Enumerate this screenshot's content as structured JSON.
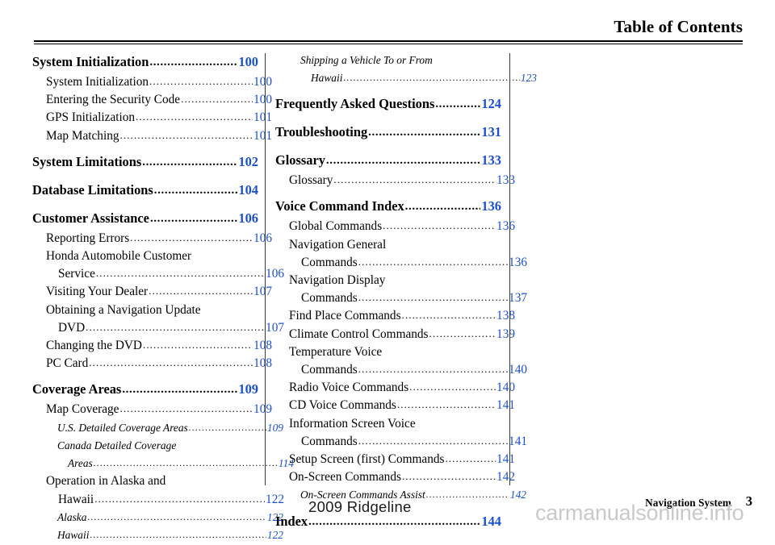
{
  "header": {
    "title": "Table of Contents"
  },
  "footer": {
    "model": "2009  Ridgeline",
    "section": "Navigation System",
    "page_number": "3",
    "watermark": "carmanualsonline.info"
  },
  "colors": {
    "page_number_blue": "#1a4fd0",
    "text_black": "#000000",
    "watermark_gray": "#c9c9c9",
    "divider_gray": "#3a3a3a"
  },
  "leader": "..................................................................................",
  "toc": {
    "left_column": [
      {
        "level": 1,
        "label": "System Initialization",
        "page": "100"
      },
      {
        "level": 2,
        "label": "System Initialization",
        "page": "100"
      },
      {
        "level": 2,
        "label": "Entering the Security Code",
        "page": "100"
      },
      {
        "level": 2,
        "label": "GPS Initialization",
        "page": "101"
      },
      {
        "level": 2,
        "label": "Map Matching",
        "page": "101"
      },
      {
        "level": 1,
        "label": "System Limitations",
        "page": "102"
      },
      {
        "level": 1,
        "label": "Database Limitations",
        "page": "104"
      },
      {
        "level": 1,
        "label": "Customer Assistance",
        "page": "106"
      },
      {
        "level": 2,
        "label": "Reporting Errors",
        "page": "106"
      },
      {
        "level": 2,
        "label": "Honda Automobile Customer",
        "page": "",
        "textonly": true
      },
      {
        "level": 2,
        "label": "Service",
        "page": "106",
        "cont": true
      },
      {
        "level": 2,
        "label": "Visiting Your Dealer",
        "page": "107"
      },
      {
        "level": 2,
        "label": "Obtaining a Navigation Update",
        "page": "",
        "textonly": true
      },
      {
        "level": 2,
        "label": "DVD",
        "page": "107",
        "cont": true
      },
      {
        "level": 2,
        "label": "Changing the DVD",
        "page": "108"
      },
      {
        "level": 2,
        "label": "PC Card",
        "page": "108"
      },
      {
        "level": 1,
        "label": "Coverage Areas",
        "page": "109"
      },
      {
        "level": 2,
        "label": "Map Coverage",
        "page": "109"
      },
      {
        "level": 3,
        "label": "U.S. Detailed Coverage Areas",
        "page": "109"
      },
      {
        "level": 3,
        "label": "Canada Detailed Coverage",
        "page": "",
        "textonly": true
      },
      {
        "level": 3,
        "label": "Areas",
        "page": "114",
        "cont": true
      },
      {
        "level": 2,
        "label": "Operation in Alaska and",
        "page": "",
        "textonly": true
      },
      {
        "level": 2,
        "label": "Hawaii",
        "page": "122",
        "cont": true
      },
      {
        "level": 3,
        "label": "Alaska",
        "page": "122"
      },
      {
        "level": 3,
        "label": "Hawaii",
        "page": "122"
      }
    ],
    "right_column": [
      {
        "level": 3,
        "label": "Shipping a Vehicle To or From",
        "page": "",
        "textonly": true
      },
      {
        "level": 3,
        "label": "Hawaii",
        "page": "123",
        "cont": true
      },
      {
        "level": 1,
        "label": "Frequently Asked Questions",
        "page": "124"
      },
      {
        "level": 1,
        "label": "Troubleshooting",
        "page": "131"
      },
      {
        "level": 1,
        "label": "Glossary",
        "page": "133"
      },
      {
        "level": 2,
        "label": "Glossary",
        "page": "133"
      },
      {
        "level": 1,
        "label": "Voice Command Index",
        "page": "136"
      },
      {
        "level": 2,
        "label": "Global Commands",
        "page": "136"
      },
      {
        "level": 2,
        "label": "Navigation General",
        "page": "",
        "textonly": true
      },
      {
        "level": 2,
        "label": "Commands",
        "page": "136",
        "cont": true
      },
      {
        "level": 2,
        "label": "Navigation Display",
        "page": "",
        "textonly": true
      },
      {
        "level": 2,
        "label": "Commands",
        "page": "137",
        "cont": true
      },
      {
        "level": 2,
        "label": "Find Place Commands",
        "page": "138"
      },
      {
        "level": 2,
        "label": "Climate Control Commands",
        "page": "139"
      },
      {
        "level": 2,
        "label": "Temperature Voice",
        "page": "",
        "textonly": true
      },
      {
        "level": 2,
        "label": "Commands",
        "page": "140",
        "cont": true
      },
      {
        "level": 2,
        "label": "Radio Voice Commands",
        "page": "140"
      },
      {
        "level": 2,
        "label": "CD Voice Commands",
        "page": "141"
      },
      {
        "level": 2,
        "label": "Information Screen Voice",
        "page": "",
        "textonly": true
      },
      {
        "level": 2,
        "label": "Commands",
        "page": "141",
        "cont": true
      },
      {
        "level": 2,
        "label": "Setup Screen (first) Commands",
        "page": "141"
      },
      {
        "level": 2,
        "label": "On-Screen Commands",
        "page": "142"
      },
      {
        "level": 3,
        "label": "On-Screen Commands Assist",
        "page": "142"
      },
      {
        "level": 1,
        "label": "Index",
        "page": "144"
      }
    ]
  }
}
